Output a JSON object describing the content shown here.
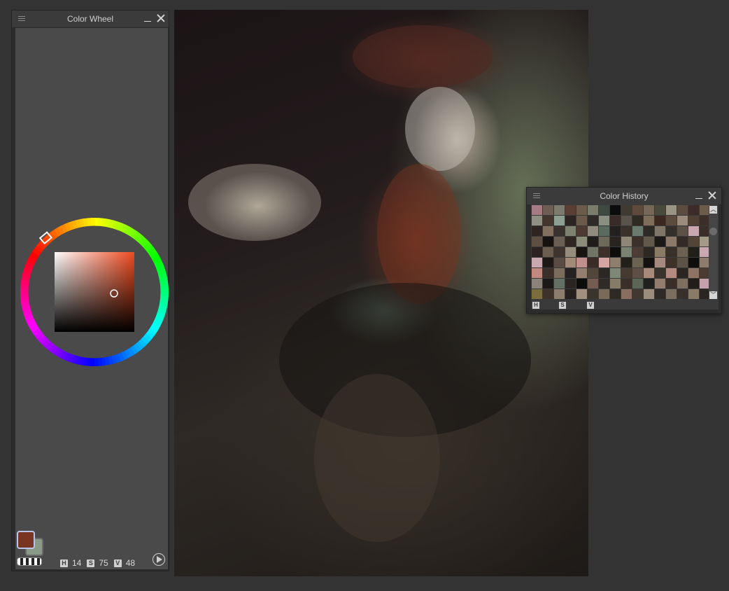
{
  "color_wheel_panel": {
    "title": "Color Wheel",
    "hsv": {
      "h_label": "H",
      "h": "14",
      "s_label": "S",
      "s": "75",
      "v_label": "V",
      "v": "48"
    },
    "main_color": "#7a3522",
    "sub_color": "#8a9a88",
    "square_hue_color": "#ee4a1f"
  },
  "color_history_panel": {
    "title": "Color History",
    "footer": {
      "h_label": "H",
      "s_label": "S",
      "v_label": "V"
    },
    "swatches": [
      "#a67b86",
      "#6d5d52",
      "#7d7a70",
      "#5a3d34",
      "#6b5b4b",
      "#7b7d6c",
      "#3d4a42",
      "#0d0c0c",
      "#3f3a32",
      "#5e4a3a",
      "#766858",
      "#4a4a3c",
      "#9a9484",
      "#5b4c3f",
      "#3b2c29",
      "#6c5b4b",
      "#8f8f84",
      "#44352e",
      "#8d9e93",
      "#2b2423",
      "#6b5a4b",
      "#2d2a27",
      "#8b8f82",
      "#392c28",
      "#5a534b",
      "#2f2a22",
      "#7e6d5a",
      "#3c2721",
      "#5b4a3d",
      "#9a8c7c",
      "#4f3f35",
      "#3b2e28",
      "#2e2522",
      "#826f60",
      "#39312d",
      "#7f8170",
      "#4d3a33",
      "#918a7f",
      "#5a6a5f",
      "#242020",
      "#3a312b",
      "#6a7a6d",
      "#2d2925",
      "#7f7668",
      "#33302b",
      "#5d5147",
      "#c7a6b0",
      "#3a2e29",
      "#5e4f45",
      "#17110f",
      "#6b5f53",
      "#2f2622",
      "#8b8c7a",
      "#1f1c1a",
      "#6d6a5c",
      "#2a2420",
      "#8f8677",
      "#3d302a",
      "#61594c",
      "#1b1816",
      "#8b7a6a",
      "#332a25",
      "#544438",
      "#a39a88",
      "#2c2320",
      "#6c5d51",
      "#3f3430",
      "#958e7e",
      "#181412",
      "#707565",
      "#3d2f2a",
      "#0e0c0b",
      "#7c8271",
      "#4c3d34",
      "#2d2824",
      "#8a7b68",
      "#3a302a",
      "#6b6051",
      "#20201b",
      "#c8a8b3",
      "#c9a8b0",
      "#1d1715",
      "#5a4c42",
      "#a18a7a",
      "#c08f8e",
      "#392c27",
      "#d3a6a4",
      "#8c7f6e",
      "#222019",
      "#6a6352",
      "#151210",
      "#a68a80",
      "#3e3129",
      "#5c5346",
      "#0f0e0d",
      "#8d7c6c",
      "#c28a7e",
      "#3a2f29",
      "#7a6d5c",
      "#252120",
      "#937f6f",
      "#524539",
      "#2b2724",
      "#7f8877",
      "#453931",
      "#5f4e43",
      "#a88a7b",
      "#3a332c",
      "#b28a80",
      "#2c2622",
      "#8e7463",
      "#4a3c33",
      "#8b837a",
      "#1b1817",
      "#637063",
      "#2a2522",
      "#0c0c0b",
      "#745c52",
      "#2f2a25",
      "#867a68",
      "#39302a",
      "#5b6656",
      "#20201e",
      "#917c6e",
      "#3a2e29",
      "#7c6f60",
      "#231d1a",
      "#c3a2ad",
      "#7a6e3e",
      "#3f3228",
      "#8d7d6e",
      "#25201e",
      "#a18f82",
      "#3b342d",
      "#7a6a5a",
      "#2f2924",
      "#886f62",
      "#413831",
      "#9b8c7d",
      "#2e2a25",
      "#7b6e5f",
      "#3a302b",
      "#8a7a68",
      "#2b2521"
    ]
  }
}
